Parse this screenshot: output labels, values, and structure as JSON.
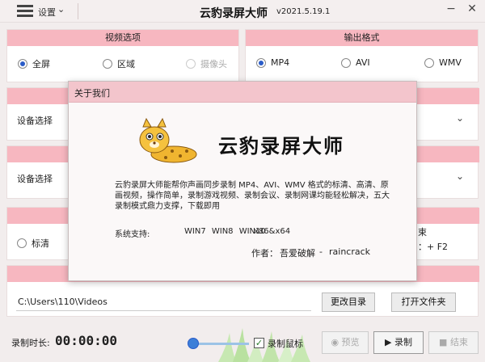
{
  "titlebar": {
    "settings_label": "设置",
    "settings_chevron": "⌄",
    "app_title": "云豹录屏大师",
    "version": "v2021.5.19.1",
    "minimize": "−",
    "close": "✕"
  },
  "video_options": {
    "header": "视频选项",
    "options": [
      {
        "label": "全屏",
        "checked": true
      },
      {
        "label": "区域",
        "checked": false
      },
      {
        "label": "摄像头",
        "checked": false,
        "disabled": true
      }
    ]
  },
  "output_format": {
    "header": "输出格式",
    "options": [
      {
        "label": "MP4",
        "checked": true
      },
      {
        "label": "AVI",
        "checked": false
      },
      {
        "label": "WMV",
        "checked": false
      }
    ]
  },
  "device_rows": [
    {
      "label": "设备选择"
    },
    {
      "label": "设备选择"
    }
  ],
  "quality": {
    "option_label": "标清"
  },
  "hotkey": {
    "partial_label": "束",
    "partial_value": "：+ F2"
  },
  "save_path": {
    "value": "C:\\Users\\110\\Videos",
    "change_dir_button": "更改目录",
    "open_folder_button": "打开文件夹"
  },
  "bottom": {
    "rec_time_label": "录制时长:",
    "rec_time": "00:00:00",
    "record_mouse_label": "录制鼠标",
    "record_mouse_checked": "✓",
    "preview_button": "预览",
    "record_button": "录制",
    "stop_button": "结束"
  },
  "about_dialog": {
    "title": "关于我们",
    "product_name": "云豹录屏大师",
    "description": "云豹录屏大师能帮你声画同步录制 MP4、AVI、WMV 格式的标清、高清、原画视频，操作简单，录制游戏视频、录制会议、录制网课均能轻松解决，五大录制模式鼎力支撑，下载即用",
    "support_label": "系统支持:",
    "support_value": "WIN7 WIN8 WIN10",
    "support_arch": "x86&x64",
    "author_label": "作者：",
    "author_name": "吾爱破解",
    "author_sep": "-",
    "author_team": "raincrack"
  },
  "colors": {
    "accent_pink": "#f7b7c0",
    "radio_blue": "#2a5cc8"
  }
}
